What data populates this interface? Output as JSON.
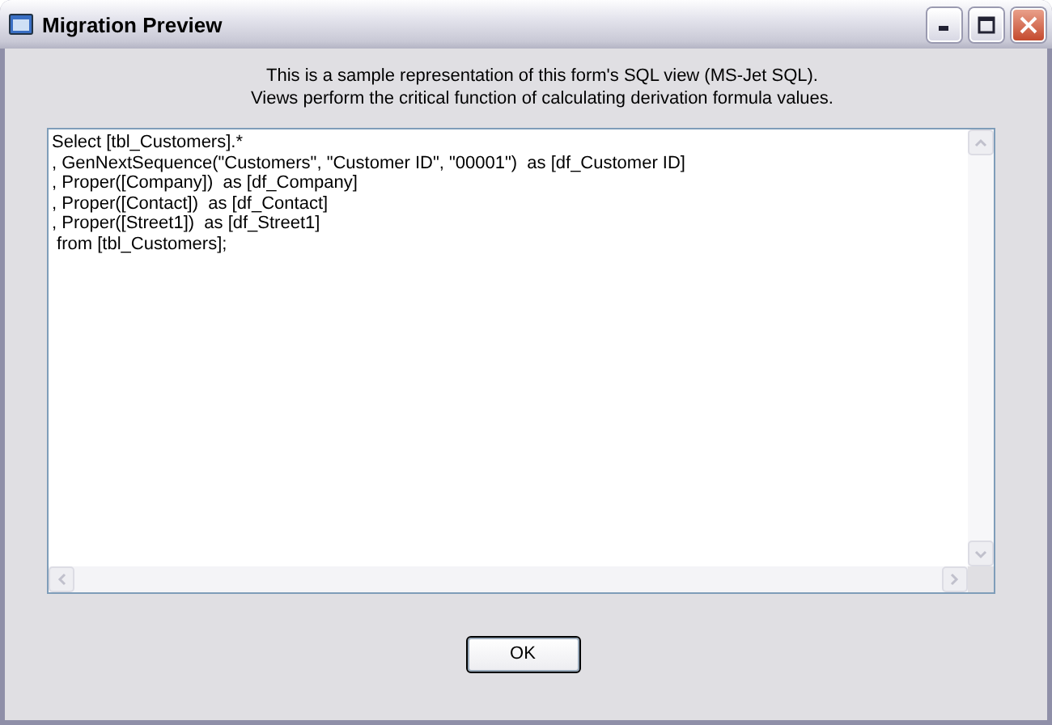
{
  "window": {
    "title": "Migration Preview"
  },
  "description": [
    "This is a sample representation of this form's SQL view (MS-Jet SQL).",
    "Views perform the critical function of calculating derivation formula values."
  ],
  "sql_lines": [
    "Select [tbl_Customers].*",
    ", GenNextSequence(\"Customers\", \"Customer ID\", \"00001\")  as [df_Customer ID]",
    ", Proper([Company])  as [df_Company]",
    ", Proper([Contact])  as [df_Contact]",
    ", Proper([Street1])  as [df_Street1]",
    " from [tbl_Customers];"
  ],
  "buttons": [
    {
      "label": "OK"
    }
  ]
}
